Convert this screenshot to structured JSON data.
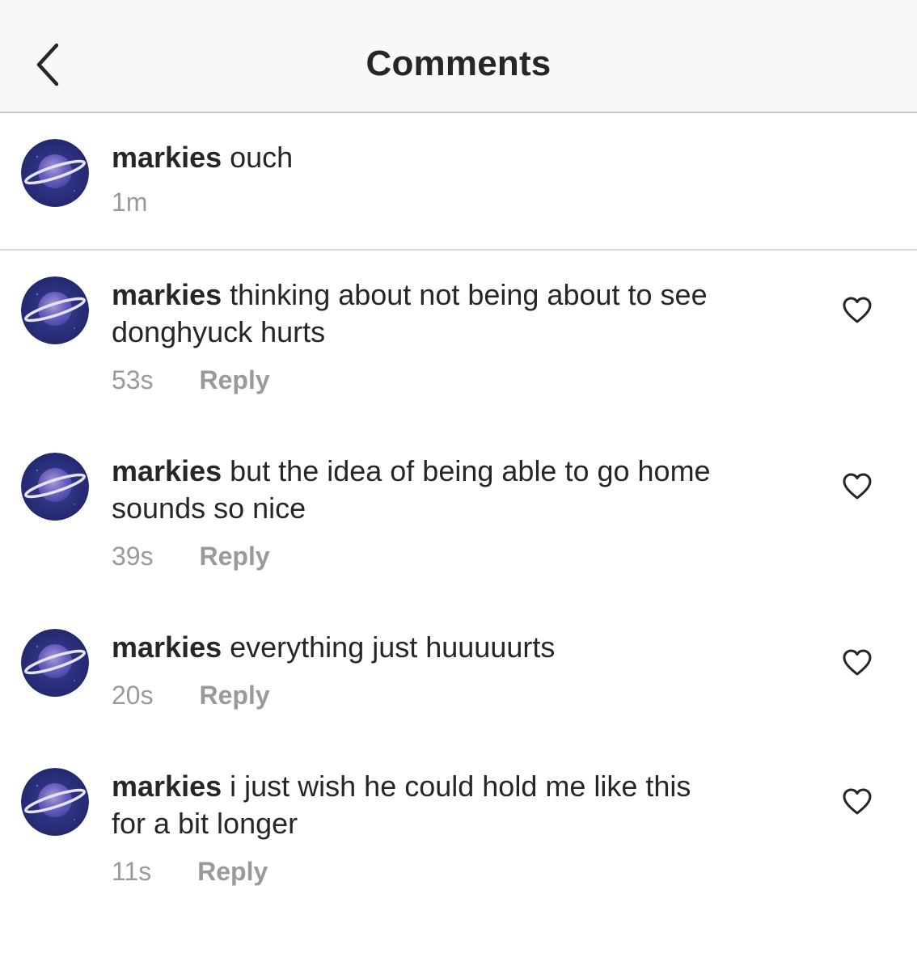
{
  "header": {
    "title": "Comments",
    "back_icon": "chevron-left-icon"
  },
  "caption": {
    "username": "markies",
    "text": "ouch",
    "time": "1m"
  },
  "comments": [
    {
      "username": "markies",
      "text": "thinking about not being about to see",
      "text2": "donghyuck hurts",
      "time": "53s",
      "reply_label": "Reply"
    },
    {
      "username": "markies",
      "text": "but the idea of being able to go home",
      "text2": "sounds so nice",
      "time": "39s",
      "reply_label": "Reply"
    },
    {
      "username": "markies",
      "text": "everything just huuuuurts",
      "text2": "",
      "time": "20s",
      "reply_label": "Reply"
    },
    {
      "username": "markies",
      "text": "i just wish he could hold me like this",
      "text2": "for a bit longer",
      "time": "11s",
      "reply_label": "Reply"
    }
  ],
  "colors": {
    "text": "#262626",
    "secondary": "#9a9a9a",
    "header_bg": "#f8f8f8",
    "avatar_bg": "#2b2f7a"
  }
}
